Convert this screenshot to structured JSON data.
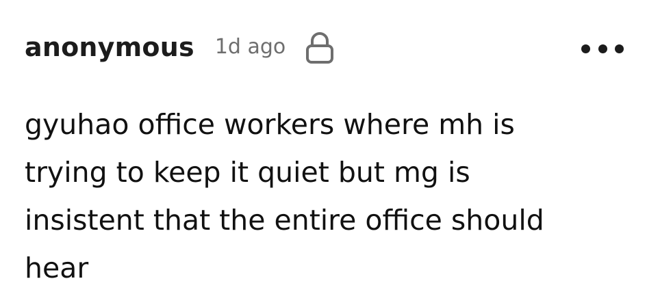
{
  "post": {
    "author": "anonymous",
    "time_ago": "1d ago",
    "visibility_icon": "lock-icon",
    "more_icon": "more-options-icon",
    "body": "gyuhao office workers where mh is\ntrying to keep it quiet but mg is\ninsistent that the entire office should\nhear"
  },
  "colors": {
    "text": "#1c1c1c",
    "muted": "#6e6e6e",
    "background": "#ffffff"
  }
}
